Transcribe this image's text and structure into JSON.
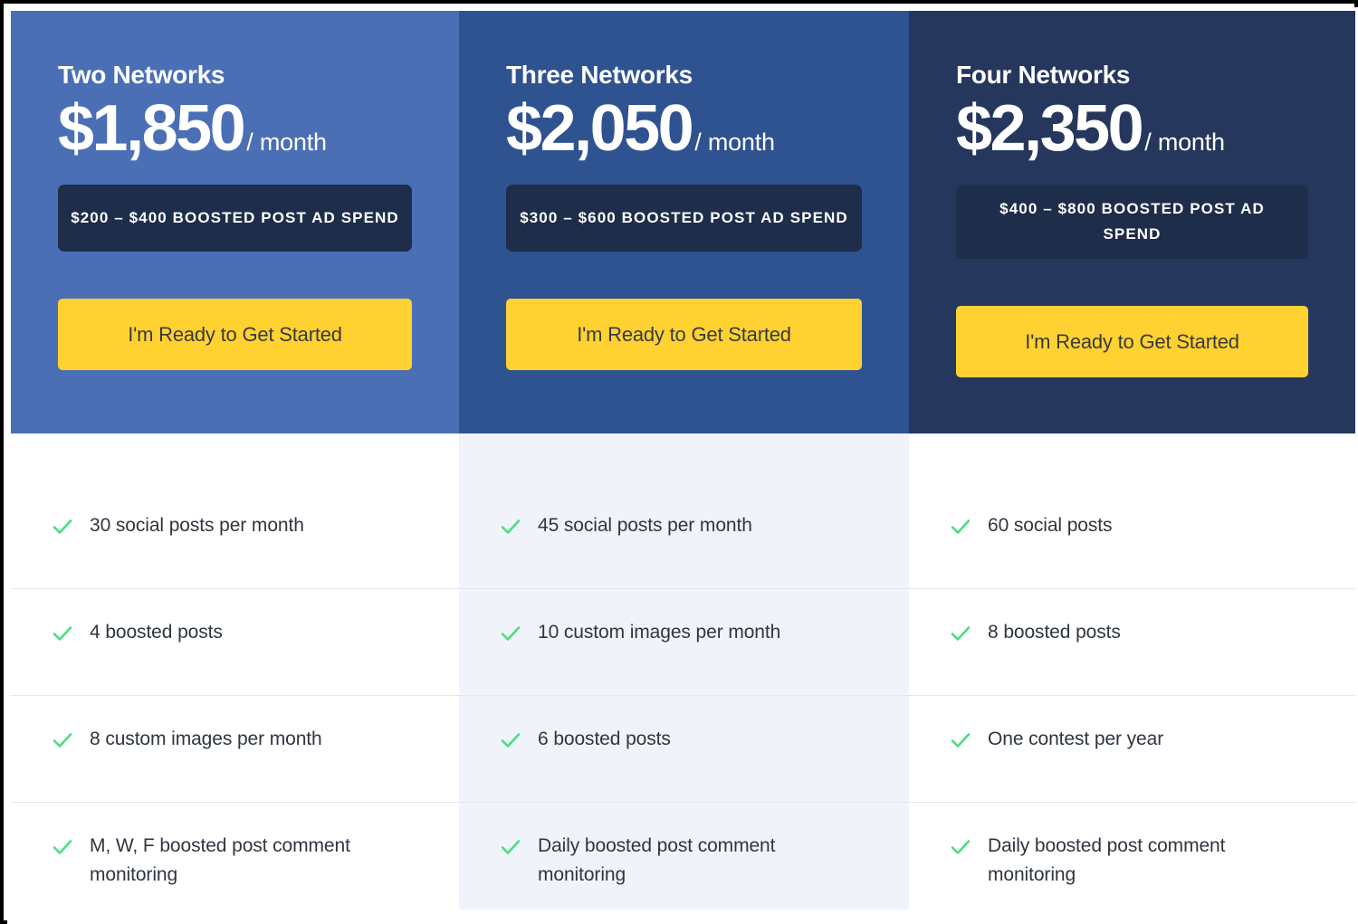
{
  "colors": {
    "plan1_bg": "#4a6fb5",
    "plan2_bg": "#2f5291",
    "plan3_bg": "#26375e",
    "badge_bg": "#1e2d4a",
    "cta_bg": "#ffd232",
    "cta_text": "#3a3a3a",
    "check_green": "#4ade80",
    "feature_text": "#2f3640",
    "divider": "#e2e8f0",
    "middle_column_bg": "#f0f4fa"
  },
  "plans": [
    {
      "name": "Two Networks",
      "price": "$1,850",
      "period": "/ month",
      "ad_spend_badge": "$200 – $400 Boosted Post Ad Spend",
      "cta_label": "I'm Ready to Get Started",
      "features": [
        "30 social posts per month",
        "4 boosted posts",
        "8 custom images per month",
        "M, W, F boosted post comment monitoring"
      ]
    },
    {
      "name": "Three Networks",
      "price": "$2,050",
      "period": "/ month",
      "ad_spend_badge": "$300 – $600 Boosted Post Ad Spend",
      "cta_label": "I'm Ready to Get Started",
      "features": [
        "45 social posts per month",
        "10 custom images per month",
        "6 boosted posts",
        "Daily boosted post comment monitoring"
      ]
    },
    {
      "name": "Four Networks",
      "price": "$2,350",
      "period": "/ month",
      "ad_spend_badge": "$400 – $800 Boosted Post Ad Spend",
      "cta_label": "I'm Ready to Get Started",
      "features": [
        "60 social posts",
        "8 boosted posts",
        "One contest per year",
        "Daily boosted post comment monitoring"
      ]
    }
  ],
  "icons": {
    "check": "check-icon"
  }
}
